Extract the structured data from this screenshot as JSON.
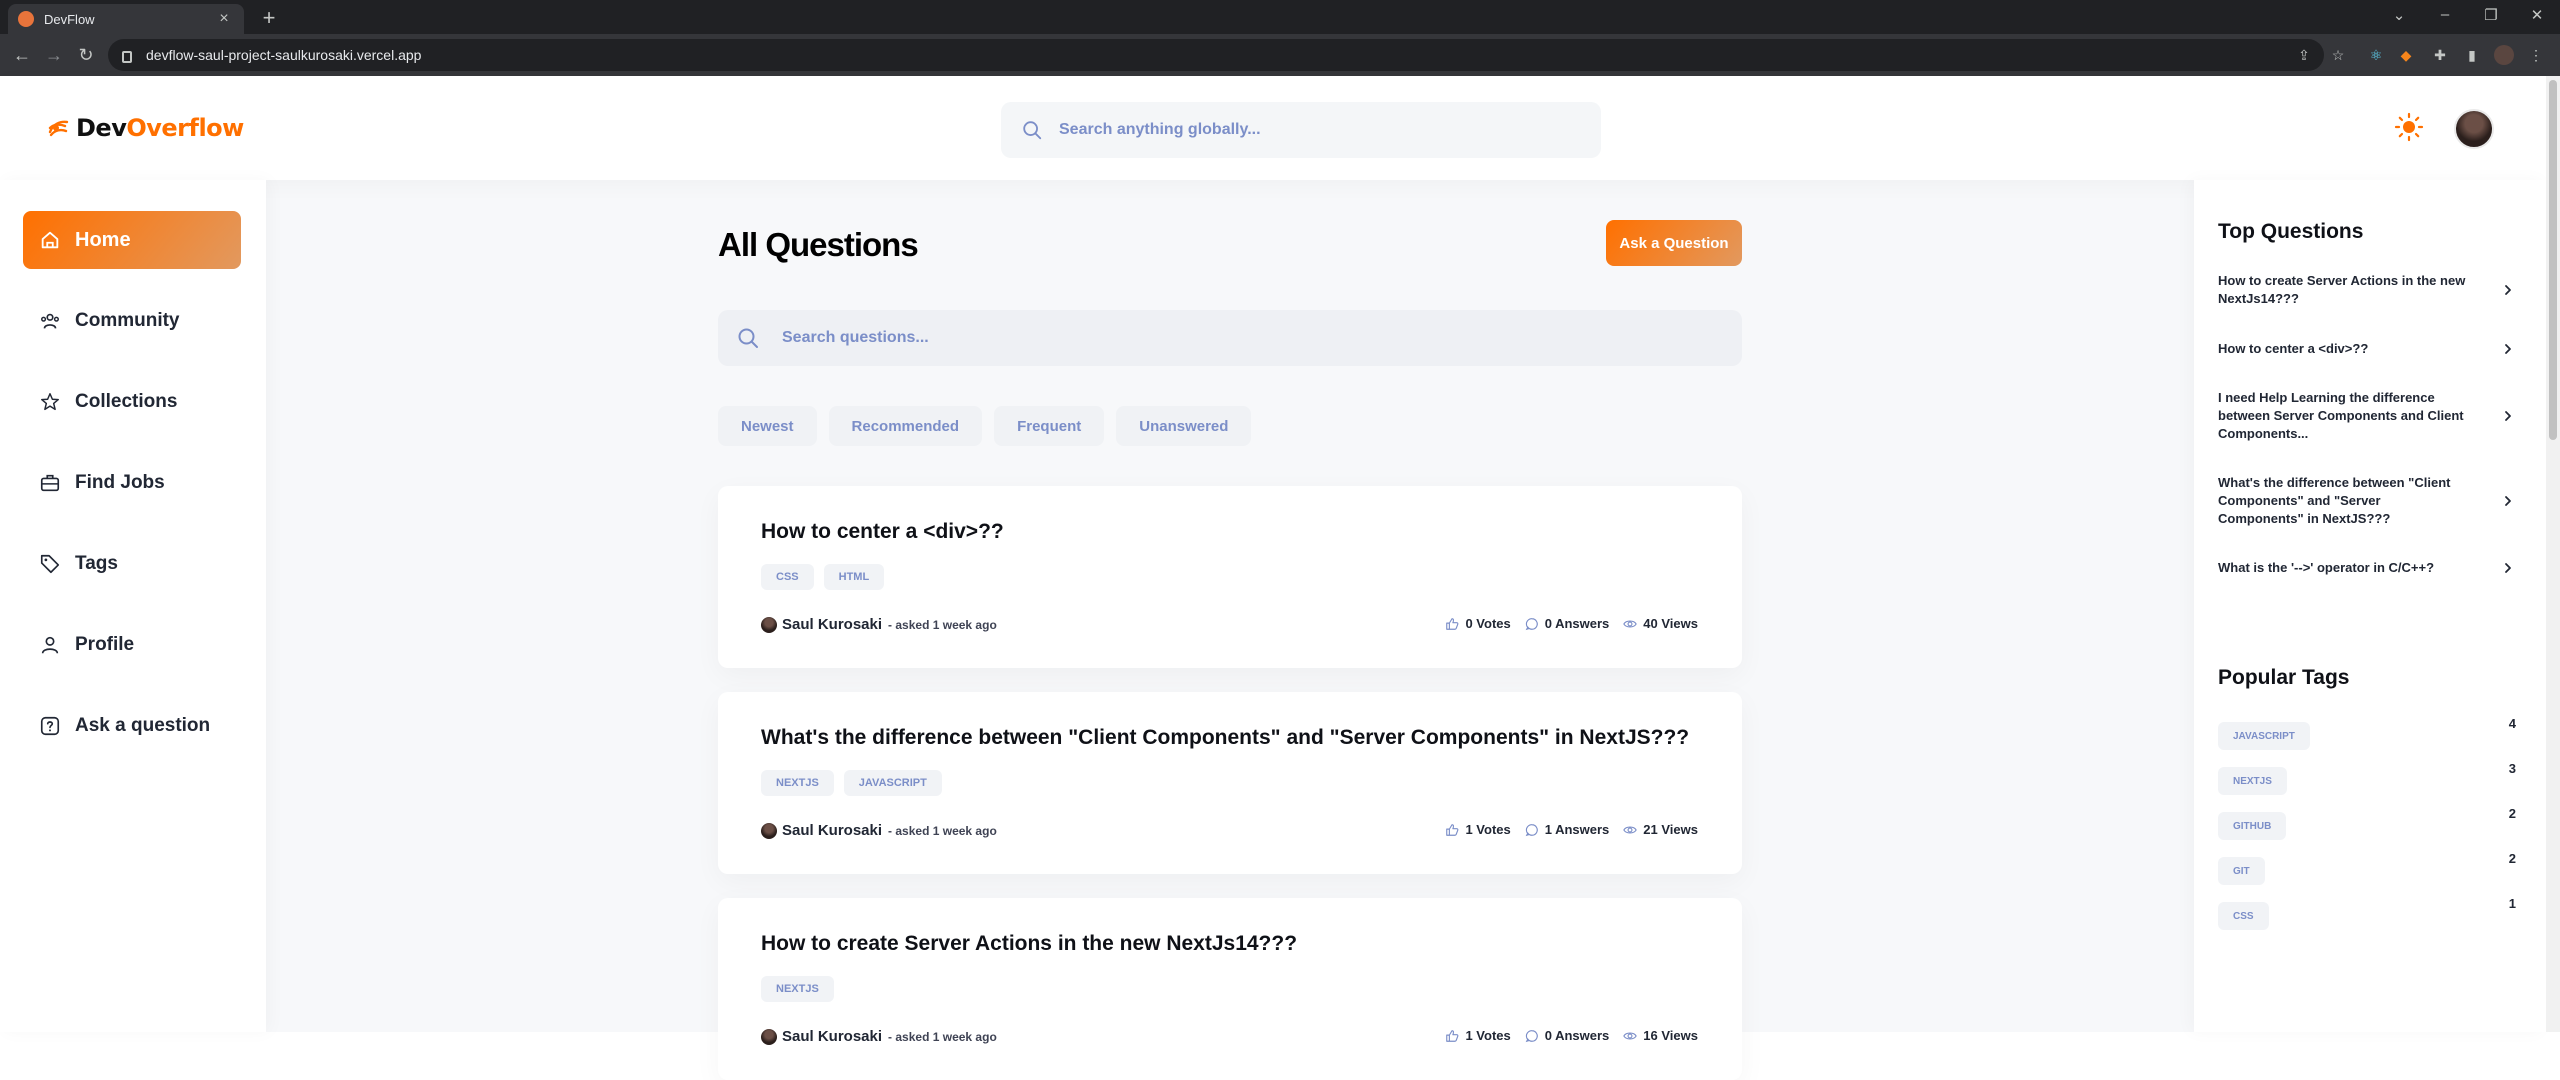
{
  "browser": {
    "tab_title": "DevFlow",
    "url": "devflow-saul-project-saulkurosaki.vercel.app"
  },
  "header": {
    "logo_prefix": "Dev",
    "logo_suffix": "Overflow",
    "search_placeholder": "Search anything globally..."
  },
  "sidebar": {
    "items": [
      {
        "label": "Home",
        "icon": "home-icon",
        "active": true
      },
      {
        "label": "Community",
        "icon": "community-icon"
      },
      {
        "label": "Collections",
        "icon": "star-icon"
      },
      {
        "label": "Find Jobs",
        "icon": "briefcase-icon"
      },
      {
        "label": "Tags",
        "icon": "tag-icon"
      },
      {
        "label": "Profile",
        "icon": "user-icon"
      },
      {
        "label": "Ask a question",
        "icon": "question-icon"
      }
    ]
  },
  "main": {
    "title": "All Questions",
    "ask_button": "Ask a Question",
    "search_placeholder": "Search questions...",
    "filters": [
      "Newest",
      "Recommended",
      "Frequent",
      "Unanswered"
    ],
    "questions": [
      {
        "title": "How to center a <div>??",
        "tags": [
          "CSS",
          "HTML"
        ],
        "author": "Saul Kurosaki",
        "asked": "- asked 1 week ago",
        "votes": "0 Votes",
        "answers": "0 Answers",
        "views": "40 Views"
      },
      {
        "title": "What's the difference between \"Client Components\" and \"Server Components\" in NextJS???",
        "tags": [
          "NEXTJS",
          "JAVASCRIPT"
        ],
        "author": "Saul Kurosaki",
        "asked": "- asked 1 week ago",
        "votes": "1 Votes",
        "answers": "1 Answers",
        "views": "21 Views"
      },
      {
        "title": "How to create Server Actions in the new NextJs14???",
        "tags": [
          "NEXTJS"
        ],
        "author": "Saul Kurosaki",
        "asked": "- asked 1 week ago",
        "votes": "1 Votes",
        "answers": "0 Answers",
        "views": "16 Views"
      }
    ]
  },
  "rightbar": {
    "top_questions_heading": "Top Questions",
    "top_questions": [
      "How to create Server Actions in the new NextJs14???",
      "How to center a <div>??",
      "I need Help Learning the difference between Server Components and Client Components...",
      "What's the difference between \"Client Components\" and \"Server Components\" in NextJS???",
      "What is the '-->' operator in C/C++?"
    ],
    "popular_tags_heading": "Popular Tags",
    "popular_tags": [
      {
        "name": "JAVASCRIPT",
        "count": "4"
      },
      {
        "name": "NEXTJS",
        "count": "3"
      },
      {
        "name": "GITHUB",
        "count": "2"
      },
      {
        "name": "GIT",
        "count": "2"
      },
      {
        "name": "CSS",
        "count": "1"
      }
    ]
  },
  "colors": {
    "accent": "#ff7000",
    "accent_light": "#e2995f",
    "muted_text": "#7b8ec8"
  }
}
